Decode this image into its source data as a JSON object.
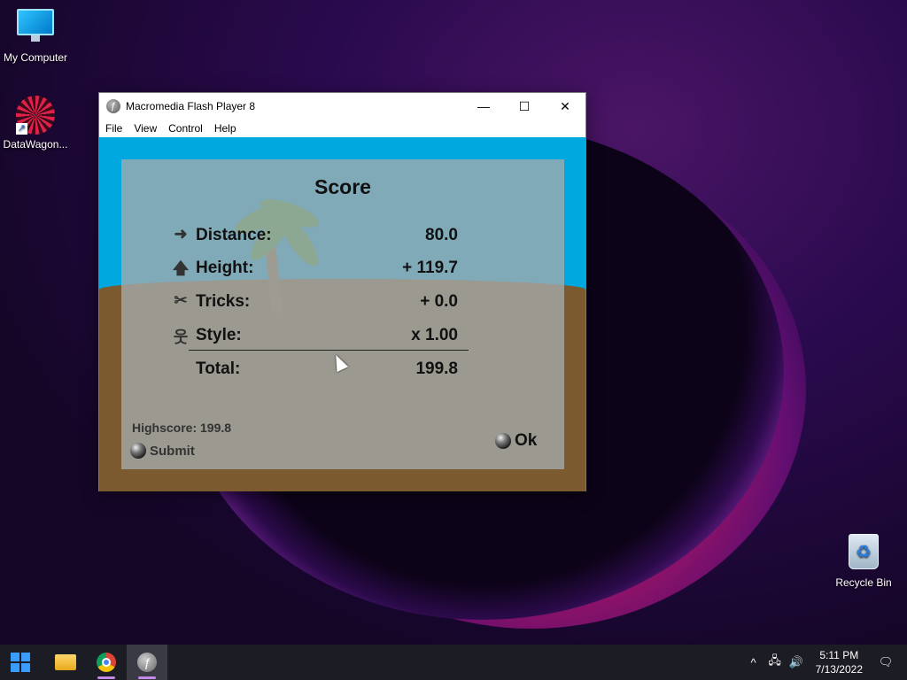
{
  "desktop": {
    "icons": [
      {
        "label": "My Computer"
      },
      {
        "label": "DataWagon..."
      },
      {
        "label": "Recycle Bin"
      }
    ]
  },
  "window": {
    "title": "Macromedia Flash Player 8",
    "controls": {
      "minimize": "—",
      "maximize": "☐",
      "close": "✕"
    },
    "menu": [
      "File",
      "View",
      "Control",
      "Help"
    ]
  },
  "score": {
    "title": "Score",
    "rows": [
      {
        "icon": "arrow-right-icon",
        "label": "Distance:",
        "value": "80.0"
      },
      {
        "icon": "arrow-up-icon",
        "label": "Height:",
        "value": "+ 119.7"
      },
      {
        "icon": "tricks-icon",
        "label": "Tricks:",
        "value": "+ 0.0"
      },
      {
        "icon": "stick-figure-icon",
        "label": "Style:",
        "value": "x 1.00"
      }
    ],
    "total": {
      "label": "Total:",
      "value": "199.8"
    },
    "highscore": "Highscore: 199.8",
    "submit_label": "Submit",
    "ok_label": "Ok"
  },
  "taskbar": {
    "tray_arrow": "^",
    "time": "5:11 PM",
    "date": "7/13/2022"
  }
}
